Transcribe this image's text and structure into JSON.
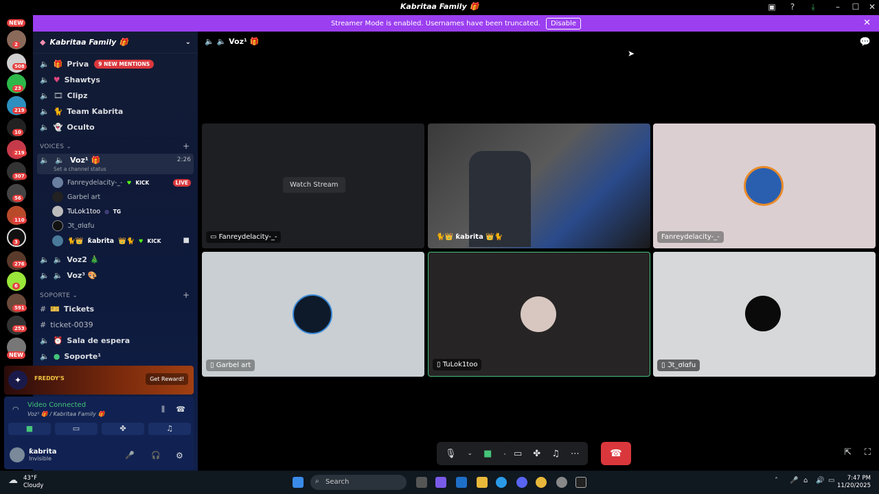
{
  "window": {
    "title": "Kabritaa Family 🎁"
  },
  "banner": {
    "text": "Streamer Mode is enabled. Usernames have been truncated.",
    "button": "Disable"
  },
  "servers": {
    "new_top": "NEW",
    "new_bottom": "NEW",
    "badges": [
      "2",
      "508",
      "23",
      "219",
      "10",
      "219",
      "307",
      "56",
      "110",
      "3",
      "276",
      "6",
      "591",
      "253"
    ]
  },
  "sidebar": {
    "guild_name": "Kabritaa Family 🎁",
    "mentions_pill": "9 NEW MENTIONS",
    "channels": [
      {
        "label": "Priva"
      },
      {
        "label": "Shawtys"
      },
      {
        "label": "Clipz"
      },
      {
        "label": "Team Kabrita"
      },
      {
        "label": "Oculto"
      }
    ],
    "voices_category": "VOICES",
    "active_voice": {
      "label": "Voz¹ 🎁",
      "time": "2:26",
      "status": "Set a channel status"
    },
    "members": [
      {
        "name": "Fanreydelacity-_-",
        "tag": "KICK",
        "live": "LIVE"
      },
      {
        "name": "Garbel art"
      },
      {
        "name": "TuLok1too",
        "tag": "TG"
      },
      {
        "name": "ℑt_σlαfu"
      },
      {
        "name": "ƙabrita",
        "tag": "KICK"
      }
    ],
    "voz2": "Voz2 🎄",
    "voz3": "Voz³ 🎨",
    "soporte_category": "SOPORTE",
    "soporte_channels": [
      {
        "label": "Tickets"
      },
      {
        "label": "ticket-0039"
      },
      {
        "label": "Sala de espera"
      },
      {
        "label": "Soporte¹"
      }
    ]
  },
  "ad": {
    "button": "Get Reward!",
    "brand": "FREDDY'S"
  },
  "voice_panel": {
    "status": "Video Connected",
    "sub": "Voz¹ 🎁 / Kabritaa Family 🎁"
  },
  "user": {
    "name": "ƙabrita",
    "status": "Invisible"
  },
  "main": {
    "channel": "Voz¹ 🎁",
    "watch_stream": "Watch Stream",
    "tiles": [
      {
        "label": "Fanreydelacity-_-"
      },
      {
        "label": "ƙabrita"
      },
      {
        "label": "Fanreydelacity-_-"
      },
      {
        "label": "Garbel art"
      },
      {
        "label": "TuLok1too"
      },
      {
        "label": "ℑt_σlαfu"
      }
    ]
  },
  "taskbar": {
    "search": "Search",
    "temp": "43°F",
    "weather": "Cloudy",
    "time": "7:47 PM",
    "date": "11/20/2025"
  },
  "colors": {
    "accent": "#9b3ff0",
    "live": "#da373c",
    "connected": "#45c47a"
  }
}
